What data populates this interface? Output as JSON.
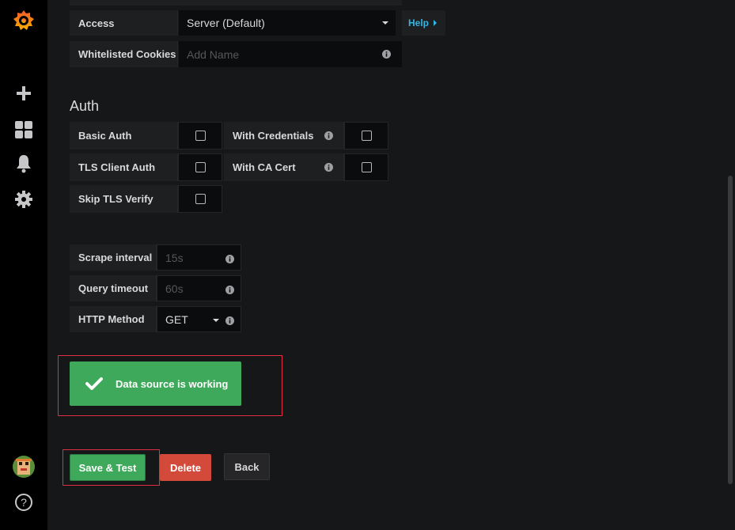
{
  "sidebar": {
    "logo_icon": "grafana-logo-icon",
    "items": [
      {
        "name": "plus-icon"
      },
      {
        "name": "dashboards-icon"
      },
      {
        "name": "bell-icon"
      },
      {
        "name": "gear-icon"
      }
    ],
    "help_label": "?"
  },
  "http": {
    "access_label": "Access",
    "access_value": "Server (Default)",
    "help_label": "Help",
    "cookies_label": "Whitelisted Cookies",
    "cookies_placeholder": "Add Name"
  },
  "auth": {
    "title": "Auth",
    "basic_auth": "Basic Auth",
    "with_credentials": "With Credentials",
    "tls_client_auth": "TLS Client Auth",
    "with_ca_cert": "With CA Cert",
    "skip_tls_verify": "Skip TLS Verify"
  },
  "prom": {
    "scrape_label": "Scrape interval",
    "scrape_placeholder": "15s",
    "timeout_label": "Query timeout",
    "timeout_placeholder": "60s",
    "method_label": "HTTP Method",
    "method_value": "GET"
  },
  "alert": {
    "text": "Data source is working"
  },
  "buttons": {
    "save": "Save & Test",
    "delete": "Delete",
    "back": "Back"
  },
  "colors": {
    "success": "#3fa95b",
    "danger": "#d44a3a",
    "link": "#33b5e5",
    "highlight": "#e02f44"
  }
}
